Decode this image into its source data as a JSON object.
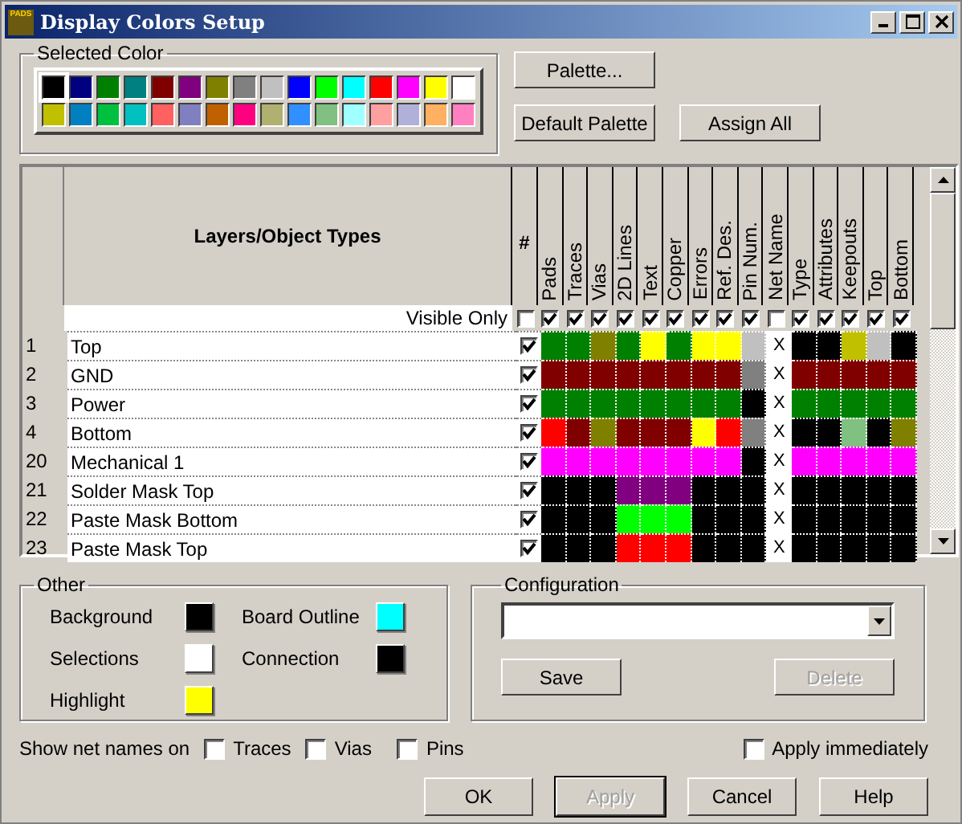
{
  "window": {
    "title": "Display Colors Setup",
    "app_icon_text": "PADS"
  },
  "selected_color": {
    "label": "Selected Color",
    "palette": [
      {
        "color": "#000000",
        "selected": true
      },
      {
        "color": "#000080",
        "selected": false
      },
      {
        "color": "#008000",
        "selected": false
      },
      {
        "color": "#008080",
        "selected": false
      },
      {
        "color": "#800000",
        "selected": false
      },
      {
        "color": "#800080",
        "selected": false
      },
      {
        "color": "#808000",
        "selected": false
      },
      {
        "color": "#808080",
        "selected": false
      },
      {
        "color": "#c0c0c0",
        "selected": false
      },
      {
        "color": "#0000ff",
        "selected": false
      },
      {
        "color": "#00ff00",
        "selected": false
      },
      {
        "color": "#00ffff",
        "selected": false
      },
      {
        "color": "#ff0000",
        "selected": false
      },
      {
        "color": "#ff00ff",
        "selected": false
      },
      {
        "color": "#ffff00",
        "selected": false
      },
      {
        "color": "#ffffff",
        "selected": false
      },
      {
        "color": "#c0c000",
        "selected": false
      },
      {
        "color": "#0080c0",
        "selected": false
      },
      {
        "color": "#00c040",
        "selected": false
      },
      {
        "color": "#00c0c0",
        "selected": false
      },
      {
        "color": "#ff6060",
        "selected": false
      },
      {
        "color": "#8080c0",
        "selected": false
      },
      {
        "color": "#c06000",
        "selected": false
      },
      {
        "color": "#ff0080",
        "selected": false
      },
      {
        "color": "#b0b070",
        "selected": false
      },
      {
        "color": "#3090ff",
        "selected": false
      },
      {
        "color": "#80c080",
        "selected": false
      },
      {
        "color": "#a0ffff",
        "selected": false
      },
      {
        "color": "#ffa0a0",
        "selected": false
      },
      {
        "color": "#b0b0d8",
        "selected": false
      },
      {
        "color": "#ffb060",
        "selected": false
      },
      {
        "color": "#ff80c0",
        "selected": false
      }
    ]
  },
  "top_buttons": [
    {
      "label": "Palette..."
    },
    {
      "label": "Default Palette"
    },
    {
      "label": "Assign All"
    }
  ],
  "table": {
    "name_heading": "Layers/Object Types",
    "hash_heading": "#",
    "visible_only_label": "Visible Only",
    "visible_only_checked": false,
    "columns": [
      {
        "label": "Pads",
        "checked": true
      },
      {
        "label": "Traces",
        "checked": true
      },
      {
        "label": "Vias",
        "checked": true
      },
      {
        "label": "2D Lines",
        "checked": true
      },
      {
        "label": "Text",
        "checked": true
      },
      {
        "label": "Copper",
        "checked": true
      },
      {
        "label": "Errors",
        "checked": true
      },
      {
        "label": "Ref. Des.",
        "checked": true
      },
      {
        "label": "Pin Num.",
        "checked": true
      },
      {
        "label": "Net Name",
        "checked": false
      },
      {
        "label": "Type",
        "checked": true
      },
      {
        "label": "Attributes",
        "checked": true
      },
      {
        "label": "Keepouts",
        "checked": true
      },
      {
        "label": "Top",
        "checked": true
      },
      {
        "label": "Bottom",
        "checked": true
      }
    ],
    "rows": [
      {
        "number": "1",
        "name": "Top",
        "visible": true,
        "cells": [
          {
            "kind": "color",
            "color": "#008000"
          },
          {
            "kind": "color",
            "color": "#008000"
          },
          {
            "kind": "color",
            "color": "#808000"
          },
          {
            "kind": "color",
            "color": "#008000"
          },
          {
            "kind": "color",
            "color": "#ffff00"
          },
          {
            "kind": "color",
            "color": "#008000"
          },
          {
            "kind": "color",
            "color": "#ffff00"
          },
          {
            "kind": "color",
            "color": "#ffff00"
          },
          {
            "kind": "color",
            "color": "#c0c0c0"
          },
          {
            "kind": "text",
            "text": "X"
          },
          {
            "kind": "color",
            "color": "#000000"
          },
          {
            "kind": "color",
            "color": "#000000"
          },
          {
            "kind": "color",
            "color": "#c0c000"
          },
          {
            "kind": "color",
            "color": "#c0c0c0"
          },
          {
            "kind": "color",
            "color": "#000000"
          }
        ]
      },
      {
        "number": "2",
        "name": "GND",
        "visible": true,
        "cells": [
          {
            "kind": "color",
            "color": "#800000"
          },
          {
            "kind": "color",
            "color": "#800000"
          },
          {
            "kind": "color",
            "color": "#800000"
          },
          {
            "kind": "color",
            "color": "#800000"
          },
          {
            "kind": "color",
            "color": "#800000"
          },
          {
            "kind": "color",
            "color": "#800000"
          },
          {
            "kind": "color",
            "color": "#800000"
          },
          {
            "kind": "color",
            "color": "#800000"
          },
          {
            "kind": "color",
            "color": "#808080"
          },
          {
            "kind": "text",
            "text": "X"
          },
          {
            "kind": "color",
            "color": "#800000"
          },
          {
            "kind": "color",
            "color": "#800000"
          },
          {
            "kind": "color",
            "color": "#800000"
          },
          {
            "kind": "color",
            "color": "#800000"
          },
          {
            "kind": "color",
            "color": "#800000"
          }
        ]
      },
      {
        "number": "3",
        "name": "Power",
        "visible": true,
        "cells": [
          {
            "kind": "color",
            "color": "#008000"
          },
          {
            "kind": "color",
            "color": "#008000"
          },
          {
            "kind": "color",
            "color": "#008000"
          },
          {
            "kind": "color",
            "color": "#008000"
          },
          {
            "kind": "color",
            "color": "#008000"
          },
          {
            "kind": "color",
            "color": "#008000"
          },
          {
            "kind": "color",
            "color": "#008000"
          },
          {
            "kind": "color",
            "color": "#008000"
          },
          {
            "kind": "color",
            "color": "#000000"
          },
          {
            "kind": "text",
            "text": "X"
          },
          {
            "kind": "color",
            "color": "#008000"
          },
          {
            "kind": "color",
            "color": "#008000"
          },
          {
            "kind": "color",
            "color": "#008000"
          },
          {
            "kind": "color",
            "color": "#008000"
          },
          {
            "kind": "color",
            "color": "#008000"
          }
        ]
      },
      {
        "number": "4",
        "name": "Bottom",
        "visible": true,
        "cells": [
          {
            "kind": "color",
            "color": "#ff0000"
          },
          {
            "kind": "color",
            "color": "#800000"
          },
          {
            "kind": "color",
            "color": "#808000"
          },
          {
            "kind": "color",
            "color": "#800000"
          },
          {
            "kind": "color",
            "color": "#800000"
          },
          {
            "kind": "color",
            "color": "#800000"
          },
          {
            "kind": "color",
            "color": "#ffff00"
          },
          {
            "kind": "color",
            "color": "#ff0000"
          },
          {
            "kind": "color",
            "color": "#808080"
          },
          {
            "kind": "text",
            "text": "X"
          },
          {
            "kind": "color",
            "color": "#000000"
          },
          {
            "kind": "color",
            "color": "#000000"
          },
          {
            "kind": "color",
            "color": "#80c080"
          },
          {
            "kind": "color",
            "color": "#000000"
          },
          {
            "kind": "color",
            "color": "#808000"
          }
        ]
      },
      {
        "number": "20",
        "name": "Mechanical 1",
        "visible": true,
        "cells": [
          {
            "kind": "color",
            "color": "#ff00ff"
          },
          {
            "kind": "color",
            "color": "#ff00ff"
          },
          {
            "kind": "color",
            "color": "#ff00ff"
          },
          {
            "kind": "color",
            "color": "#ff00ff"
          },
          {
            "kind": "color",
            "color": "#ff00ff"
          },
          {
            "kind": "color",
            "color": "#ff00ff"
          },
          {
            "kind": "color",
            "color": "#ff00ff"
          },
          {
            "kind": "color",
            "color": "#ff00ff"
          },
          {
            "kind": "color",
            "color": "#000000"
          },
          {
            "kind": "text",
            "text": "X"
          },
          {
            "kind": "color",
            "color": "#ff00ff"
          },
          {
            "kind": "color",
            "color": "#ff00ff"
          },
          {
            "kind": "color",
            "color": "#ff00ff"
          },
          {
            "kind": "color",
            "color": "#ff00ff"
          },
          {
            "kind": "color",
            "color": "#ff00ff"
          }
        ]
      },
      {
        "number": "21",
        "name": "Solder Mask Top",
        "visible": true,
        "cells": [
          {
            "kind": "color",
            "color": "#000000"
          },
          {
            "kind": "color",
            "color": "#000000"
          },
          {
            "kind": "color",
            "color": "#000000"
          },
          {
            "kind": "color",
            "color": "#800080"
          },
          {
            "kind": "color",
            "color": "#800080"
          },
          {
            "kind": "color",
            "color": "#800080"
          },
          {
            "kind": "color",
            "color": "#000000"
          },
          {
            "kind": "color",
            "color": "#000000"
          },
          {
            "kind": "color",
            "color": "#000000"
          },
          {
            "kind": "text",
            "text": "X"
          },
          {
            "kind": "color",
            "color": "#000000"
          },
          {
            "kind": "color",
            "color": "#000000"
          },
          {
            "kind": "color",
            "color": "#000000"
          },
          {
            "kind": "color",
            "color": "#000000"
          },
          {
            "kind": "color",
            "color": "#000000"
          }
        ]
      },
      {
        "number": "22",
        "name": "Paste Mask Bottom",
        "visible": true,
        "cells": [
          {
            "kind": "color",
            "color": "#000000"
          },
          {
            "kind": "color",
            "color": "#000000"
          },
          {
            "kind": "color",
            "color": "#000000"
          },
          {
            "kind": "color",
            "color": "#00ff00"
          },
          {
            "kind": "color",
            "color": "#00ff00"
          },
          {
            "kind": "color",
            "color": "#00ff00"
          },
          {
            "kind": "color",
            "color": "#000000"
          },
          {
            "kind": "color",
            "color": "#000000"
          },
          {
            "kind": "color",
            "color": "#000000"
          },
          {
            "kind": "text",
            "text": "X"
          },
          {
            "kind": "color",
            "color": "#000000"
          },
          {
            "kind": "color",
            "color": "#000000"
          },
          {
            "kind": "color",
            "color": "#000000"
          },
          {
            "kind": "color",
            "color": "#000000"
          },
          {
            "kind": "color",
            "color": "#000000"
          }
        ]
      },
      {
        "number": "23",
        "name": "Paste Mask Top",
        "visible": true,
        "cells": [
          {
            "kind": "color",
            "color": "#000000"
          },
          {
            "kind": "color",
            "color": "#000000"
          },
          {
            "kind": "color",
            "color": "#000000"
          },
          {
            "kind": "color",
            "color": "#ff0000"
          },
          {
            "kind": "color",
            "color": "#ff0000"
          },
          {
            "kind": "color",
            "color": "#ff0000"
          },
          {
            "kind": "color",
            "color": "#000000"
          },
          {
            "kind": "color",
            "color": "#000000"
          },
          {
            "kind": "color",
            "color": "#000000"
          },
          {
            "kind": "text",
            "text": "X"
          },
          {
            "kind": "color",
            "color": "#000000"
          },
          {
            "kind": "color",
            "color": "#000000"
          },
          {
            "kind": "color",
            "color": "#000000"
          },
          {
            "kind": "color",
            "color": "#000000"
          },
          {
            "kind": "color",
            "color": "#000000"
          }
        ]
      }
    ]
  },
  "other": {
    "label": "Other",
    "items": [
      {
        "label": "Background",
        "color": "#000000"
      },
      {
        "label": "Board Outline",
        "color": "#00ffff"
      },
      {
        "label": "Selections",
        "color": "#ffffff"
      },
      {
        "label": "Connection",
        "color": "#000000"
      },
      {
        "label": "Highlight",
        "color": "#ffff00"
      }
    ]
  },
  "configuration": {
    "label": "Configuration",
    "save": {
      "label": "Save",
      "disabled": false
    },
    "delete": {
      "label": "Delete",
      "disabled": true
    }
  },
  "show_net_names": {
    "label": "Show net names on",
    "options": [
      {
        "label": "Traces",
        "checked": false
      },
      {
        "label": "Vias",
        "checked": false
      },
      {
        "label": "Pins",
        "checked": false
      }
    ]
  },
  "apply_immediately": {
    "label": "Apply immediately",
    "checked": false
  },
  "buttons": [
    {
      "label": "OK",
      "disabled": false,
      "default": false
    },
    {
      "label": "Apply",
      "disabled": true,
      "default": true
    },
    {
      "label": "Cancel",
      "disabled": false,
      "default": false
    },
    {
      "label": "Help",
      "disabled": false,
      "default": false
    }
  ]
}
